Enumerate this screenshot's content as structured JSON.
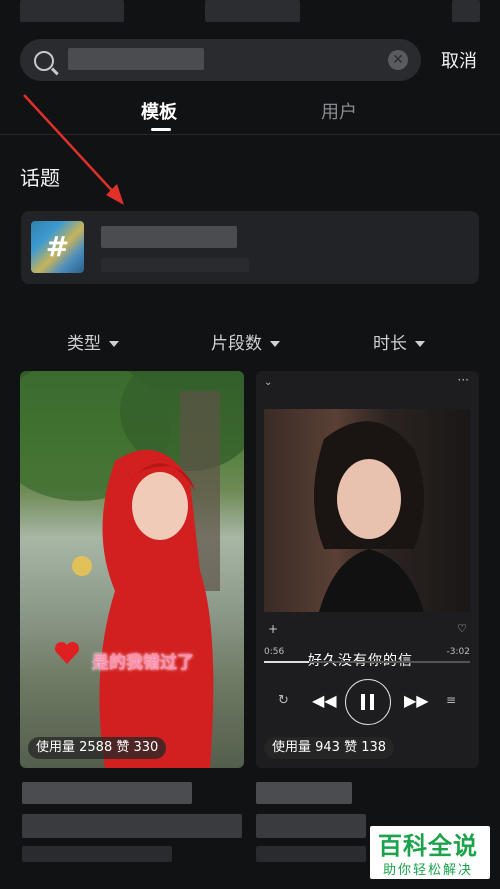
{
  "search": {
    "placeholder": "",
    "cancel_label": "取消"
  },
  "tabs": [
    {
      "label": "模板",
      "active": true
    },
    {
      "label": "用户",
      "active": false
    }
  ],
  "topic_section": {
    "title": "话题",
    "thumb_symbol": "#"
  },
  "filters": [
    {
      "label": "类型"
    },
    {
      "label": "片段数"
    },
    {
      "label": "时长"
    }
  ],
  "cards": [
    {
      "caption": "是的我错过了",
      "usage": "使用量 2588 赞 330"
    },
    {
      "lyric": "好久没有你的信",
      "time_start": "0:56",
      "time_end": "-3:02",
      "progress": 0.22,
      "usage": "使用量 943 赞 138"
    }
  ],
  "watermark": {
    "main": "百科全说",
    "sub": "助你轻松解决"
  },
  "colors": {
    "background": "#111214",
    "arrow": "#e0302a",
    "accent_text": "#ffffff",
    "watermark": "#1aa34a"
  },
  "icons": [
    "search-icon",
    "clear-icon",
    "caret-down-icon",
    "heart-icon",
    "play-pause-icon",
    "previous-icon",
    "next-icon",
    "repeat-icon"
  ]
}
